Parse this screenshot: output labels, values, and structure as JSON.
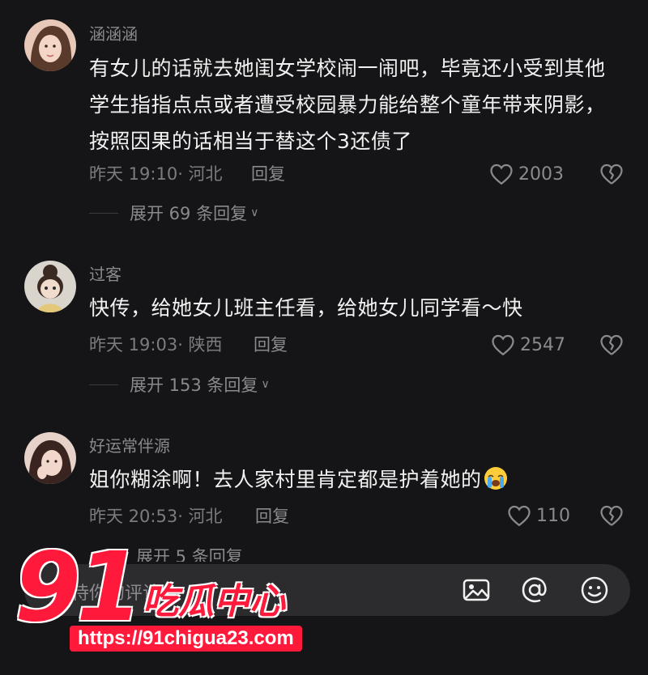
{
  "comments": [
    {
      "username": "涵涵涵",
      "content": "有女儿的话就去她闺女学校闹一闹吧，毕竟还小受到其他学生指指点点或者遭受校园暴力能给整个童年带来阴影，按照因果的话相当于替这个3还债了",
      "time": "昨天 19:10",
      "location": "· 河北",
      "reply_label": "回复",
      "likes": "2003",
      "expand": "展开 69 条回复"
    },
    {
      "username": "过客",
      "content": "快传，给她女儿班主任看，给她女儿同学看～快",
      "time": "昨天 19:03",
      "location": "· 陕西",
      "reply_label": "回复",
      "likes": "2547",
      "expand": "展开 153 条回复"
    },
    {
      "username": "好运常伴源",
      "content": "姐你糊涂啊！去人家村里肯定都是护着她的",
      "time": "昨天 20:53",
      "location": "· 河北",
      "reply_label": "回复",
      "likes": "110",
      "expand": "展开 5 条回复"
    }
  ],
  "input": {
    "placeholder": "期待你的评论"
  },
  "icons": {
    "like": "heart-outline-icon",
    "dislike": "broken-heart-icon",
    "image": "image-icon",
    "mention": "at-icon",
    "emoji": "smiley-icon",
    "inline_emoji": "crying-face-emoji"
  },
  "watermark": {
    "number": "91",
    "name": "吃瓜中心",
    "url": "https://91chigua23.com"
  },
  "colors": {
    "background": "#151517",
    "text": "#f1f1f1",
    "muted": "#8a8a8e",
    "watermark": "#ff1a3c"
  }
}
